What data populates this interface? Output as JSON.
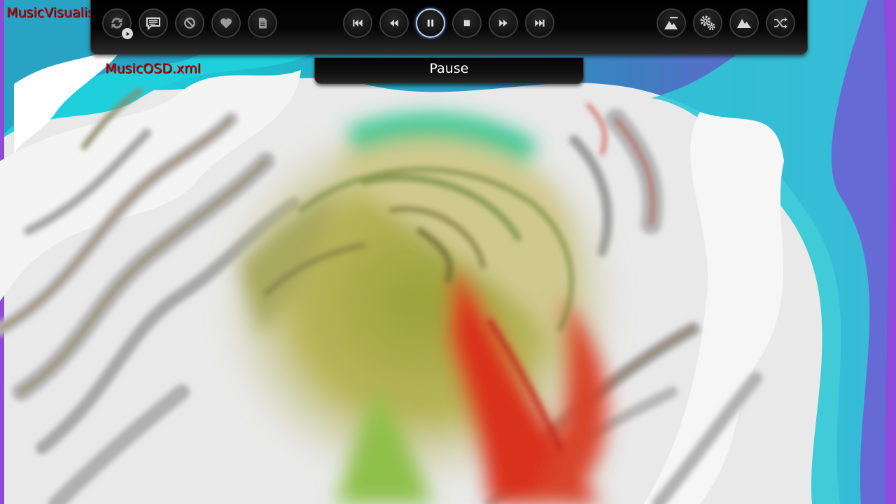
{
  "window": {
    "title": "MusicVisualisation.xml"
  },
  "osd": {
    "name": "MusicOSD.xml",
    "tooltip": "Pause",
    "left_buttons": [
      {
        "id": "repeat",
        "icon": "repeat-icon"
      },
      {
        "id": "lyrics",
        "icon": "speech-bubble-icon"
      },
      {
        "id": "block",
        "icon": "block-icon"
      },
      {
        "id": "favourite",
        "icon": "heart-icon"
      },
      {
        "id": "info",
        "icon": "document-icon"
      }
    ],
    "transport_buttons": [
      {
        "id": "previous",
        "icon": "skip-previous-icon"
      },
      {
        "id": "rewind",
        "icon": "rewind-icon"
      },
      {
        "id": "pause",
        "icon": "pause-icon",
        "active": true
      },
      {
        "id": "stop",
        "icon": "stop-icon"
      },
      {
        "id": "fast-forward",
        "icon": "fast-forward-icon"
      },
      {
        "id": "next",
        "icon": "skip-next-icon"
      }
    ],
    "right_buttons": [
      {
        "id": "visualisation-presets",
        "icon": "visualisation-preset-icon"
      },
      {
        "id": "visualisation-settings",
        "icon": "gears-icon"
      },
      {
        "id": "visualisation",
        "icon": "mountain-icon"
      },
      {
        "id": "shuffle",
        "icon": "shuffle-icon"
      }
    ]
  },
  "colors": {
    "label_text": "#cc0000",
    "active_ring": "#b9d0f2",
    "osd_background": "#000000",
    "tooltip_text": "#ffffff"
  }
}
